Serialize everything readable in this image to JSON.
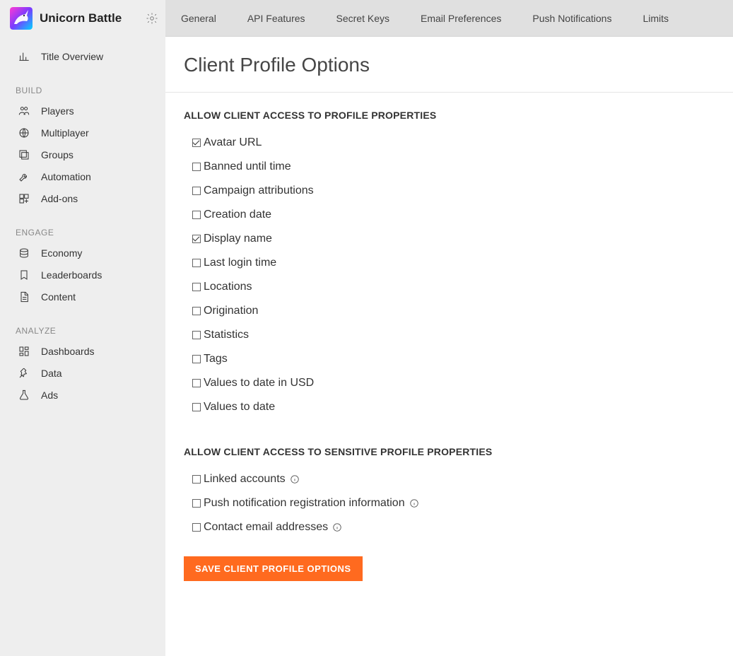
{
  "sidebar": {
    "title": "Unicorn Battle",
    "overview_label": "Title Overview",
    "sections": [
      {
        "title": "BUILD",
        "items": [
          {
            "label": "Players",
            "icon": "players-icon"
          },
          {
            "label": "Multiplayer",
            "icon": "globe-icon"
          },
          {
            "label": "Groups",
            "icon": "layers-icon"
          },
          {
            "label": "Automation",
            "icon": "wrench-icon"
          },
          {
            "label": "Add-ons",
            "icon": "addons-icon"
          }
        ]
      },
      {
        "title": "ENGAGE",
        "items": [
          {
            "label": "Economy",
            "icon": "coins-icon"
          },
          {
            "label": "Leaderboards",
            "icon": "bookmark-icon"
          },
          {
            "label": "Content",
            "icon": "file-icon"
          }
        ]
      },
      {
        "title": "ANALYZE",
        "items": [
          {
            "label": "Dashboards",
            "icon": "dashboard-icon"
          },
          {
            "label": "Data",
            "icon": "pin-icon"
          },
          {
            "label": "Ads",
            "icon": "flask-icon"
          }
        ]
      }
    ]
  },
  "tabs": [
    "General",
    "API Features",
    "Secret Keys",
    "Email Preferences",
    "Push Notifications",
    "Limits"
  ],
  "page": {
    "title": "Client Profile Options",
    "save_button_label": "SAVE CLIENT PROFILE OPTIONS",
    "sections": [
      {
        "heading": "ALLOW CLIENT ACCESS TO PROFILE PROPERTIES",
        "options": [
          {
            "label": "Avatar URL",
            "checked": true,
            "info": false
          },
          {
            "label": "Banned until time",
            "checked": false,
            "info": false
          },
          {
            "label": "Campaign attributions",
            "checked": false,
            "info": false
          },
          {
            "label": "Creation date",
            "checked": false,
            "info": false
          },
          {
            "label": "Display name",
            "checked": true,
            "info": false
          },
          {
            "label": "Last login time",
            "checked": false,
            "info": false
          },
          {
            "label": "Locations",
            "checked": false,
            "info": false
          },
          {
            "label": "Origination",
            "checked": false,
            "info": false
          },
          {
            "label": "Statistics",
            "checked": false,
            "info": false
          },
          {
            "label": "Tags",
            "checked": false,
            "info": false
          },
          {
            "label": "Values to date in USD",
            "checked": false,
            "info": false
          },
          {
            "label": "Values to date",
            "checked": false,
            "info": false
          }
        ]
      },
      {
        "heading": "ALLOW CLIENT ACCESS TO SENSITIVE PROFILE PROPERTIES",
        "options": [
          {
            "label": "Linked accounts",
            "checked": false,
            "info": true
          },
          {
            "label": "Push notification registration information",
            "checked": false,
            "info": true
          },
          {
            "label": "Contact email addresses",
            "checked": false,
            "info": true
          }
        ]
      }
    ]
  }
}
